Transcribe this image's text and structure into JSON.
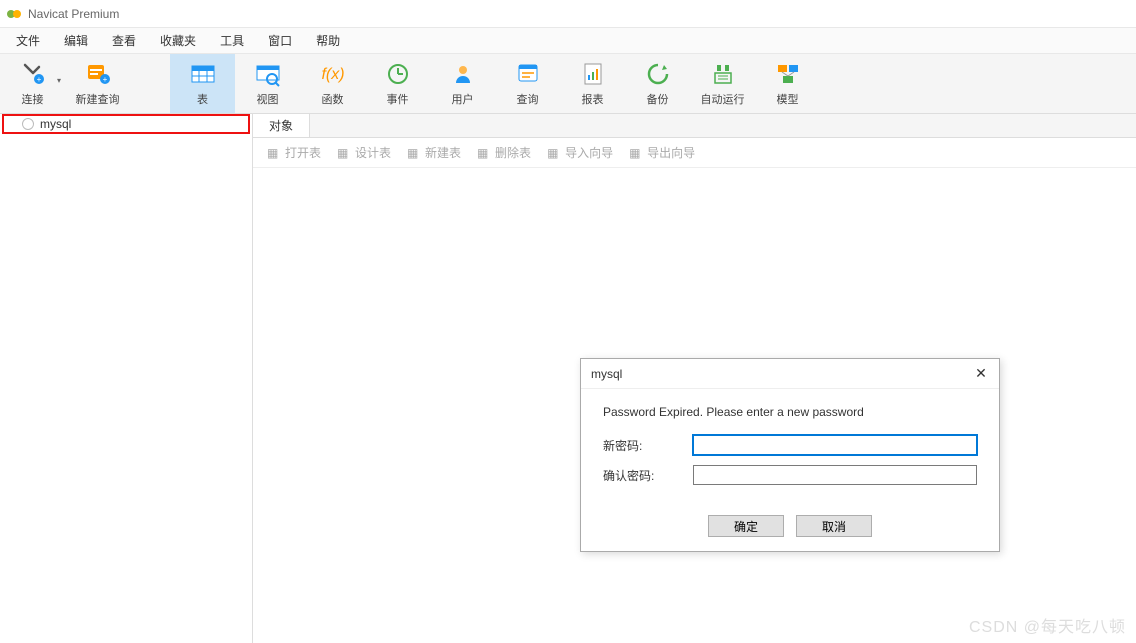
{
  "window": {
    "title": "Navicat Premium"
  },
  "menus": [
    "文件",
    "编辑",
    "查看",
    "收藏夹",
    "工具",
    "窗口",
    "帮助"
  ],
  "toolbar": [
    {
      "name": "connect",
      "label": "连接",
      "icon": "connect",
      "dropdown": true
    },
    {
      "name": "new-query",
      "label": "新建查询",
      "icon": "query",
      "dropdown": false
    },
    {
      "name": "table",
      "label": "表",
      "icon": "table",
      "active": true
    },
    {
      "name": "view",
      "label": "视图",
      "icon": "view"
    },
    {
      "name": "function",
      "label": "函数",
      "icon": "fx"
    },
    {
      "name": "event",
      "label": "事件",
      "icon": "event"
    },
    {
      "name": "user",
      "label": "用户",
      "icon": "user"
    },
    {
      "name": "query2",
      "label": "查询",
      "icon": "query2"
    },
    {
      "name": "report",
      "label": "报表",
      "icon": "report"
    },
    {
      "name": "backup",
      "label": "备份",
      "icon": "backup"
    },
    {
      "name": "autorun",
      "label": "自动运行",
      "icon": "auto"
    },
    {
      "name": "model",
      "label": "模型",
      "icon": "model"
    }
  ],
  "sidebar": {
    "connection": "mysql"
  },
  "tabs": [
    {
      "label": "对象"
    }
  ],
  "subtoolbar": [
    "打开表",
    "设计表",
    "新建表",
    "删除表",
    "导入向导",
    "导出向导"
  ],
  "dialog": {
    "title": "mysql",
    "message": "Password Expired. Please enter a new password",
    "newPassLabel": "新密码:",
    "confirmPassLabel": "确认密码:",
    "newPassValue": "",
    "confirmPassValue": "",
    "ok": "确定",
    "cancel": "取消"
  },
  "watermark": "CSDN @每天吃八顿"
}
